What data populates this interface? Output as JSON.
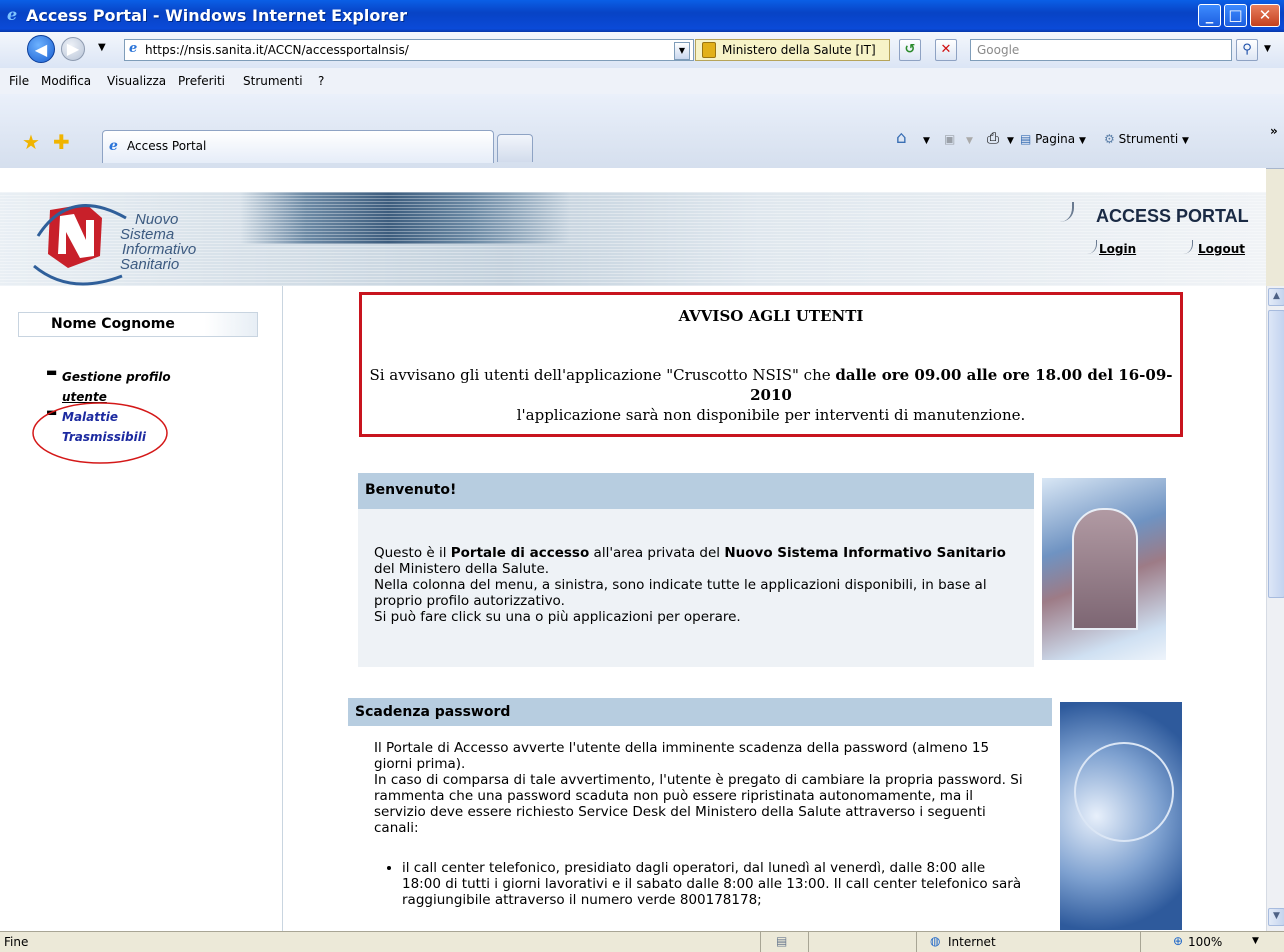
{
  "window": {
    "title": "Access Portal - Windows Internet Explorer"
  },
  "address_bar": {
    "url": "https://nsis.sanita.it/ACCN/accessportalnsis/",
    "security_label": "Ministero della Salute [IT]",
    "search_placeholder": "Google"
  },
  "menu": {
    "items": [
      "File",
      "Modifica",
      "Visualizza",
      "Preferiti",
      "Strumenti",
      "?"
    ]
  },
  "tabs": [
    {
      "label": "Access Portal"
    }
  ],
  "command_bar": {
    "page_label": "Pagina",
    "tools_label": "Strumenti"
  },
  "header": {
    "logo_words": [
      "Nuovo",
      "Sistema",
      "Informativo",
      "Sanitario"
    ],
    "title": "ACCESS PORTAL",
    "login": "Login",
    "logout": "Logout"
  },
  "sidebar": {
    "user_name": "Nome Cognome",
    "links": [
      {
        "label": "Gestione profilo utente",
        "lines": [
          "Gestione profilo",
          "utente"
        ]
      },
      {
        "label": "Malattie Trasmissibili",
        "lines": [
          "Malattie",
          "Trasmissibili"
        ]
      }
    ]
  },
  "notice": {
    "title": "AVVISO AGLI UTENTI",
    "text_before": "Si avvisano gli utenti dell'applicazione \"Cruscotto NSIS\" che ",
    "text_bold": "dalle ore 09.00 alle ore 18.00 del 16-09-2010",
    "text_after": "l'applicazione sarà non disponibile per interventi di manutenzione."
  },
  "welcome": {
    "heading": "Benvenuto!",
    "p1_a": "Questo è il ",
    "p1_b": "Portale di accesso",
    "p1_c": " all'area privata del ",
    "p1_d": "Nuovo Sistema Informativo Sanitario",
    "p1_e": " del Ministero della Salute.",
    "p2": "Nella colonna del menu, a sinistra, sono indicate tutte le applicazioni disponibili, in base al proprio profilo autorizzativo.",
    "p3": "Si può fare click su una o più applicazioni per operare."
  },
  "password": {
    "heading": "Scadenza password",
    "p1": "Il Portale di Accesso avverte l'utente della imminente scadenza della password (almeno 15 giorni prima).",
    "p2": "In caso di comparsa di tale avvertimento, l'utente è pregato di cambiare la propria password. Si rammenta che una password scaduta non può essere ripristinata autonomamente, ma il servizio deve essere richiesto Service Desk del Ministero della Salute attraverso i seguenti canali:",
    "bullet1": "il call center telefonico, presidiato dagli operatori, dal lunedì al venerdì, dalle 8:00 alle 18:00 di tutti i giorni lavorativi e il sabato dalle 8:00 alle 13:00. Il call center telefonico sarà raggiungibile attraverso il numero verde 800178178;"
  },
  "statusbar": {
    "left": "Fine",
    "zone": "Internet",
    "zoom": "100%"
  }
}
